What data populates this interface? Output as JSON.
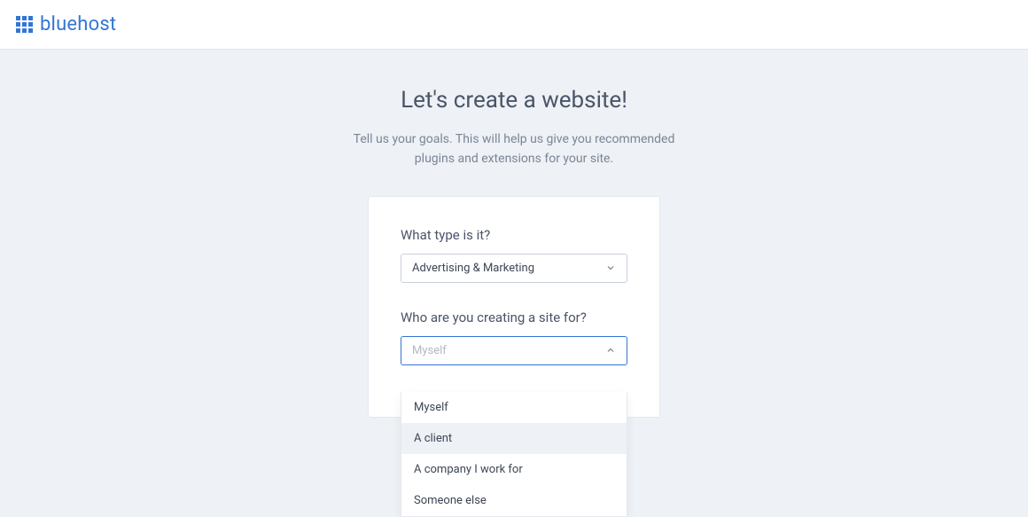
{
  "brand": {
    "name": "bluehost"
  },
  "page": {
    "title": "Let's create a website!",
    "subtitle": "Tell us your goals. This will help us give you recommended plugins and extensions for your site."
  },
  "form": {
    "type": {
      "label": "What type is it?",
      "value": "Advertising & Marketing"
    },
    "audience": {
      "label": "Who are you creating a site for?",
      "placeholder": "Myself",
      "options": [
        "Myself",
        "A client",
        "A company I work for",
        "Someone else"
      ],
      "hovered_index": 1
    }
  }
}
